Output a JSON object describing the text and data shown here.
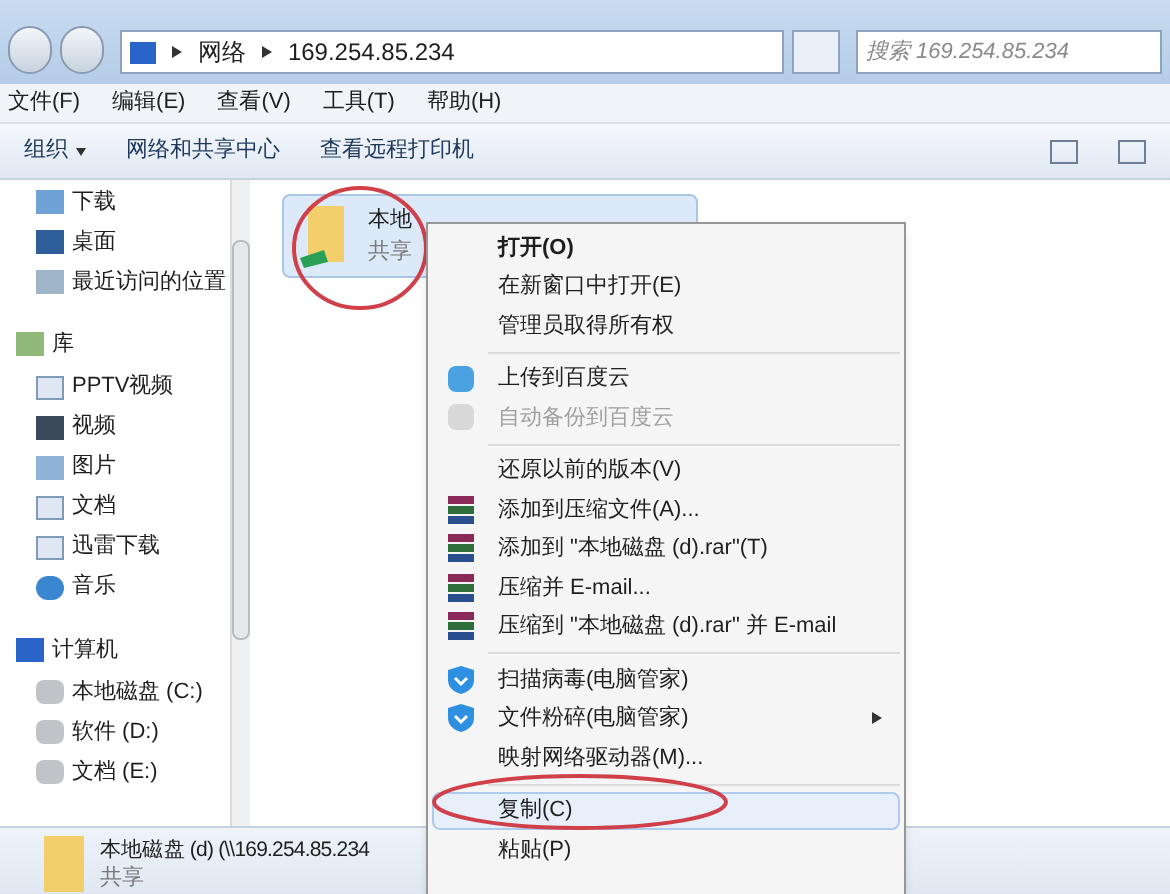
{
  "address_bar": {
    "crumbs": [
      "网络",
      "169.254.85.234"
    ]
  },
  "search": {
    "placeholder": "搜索 169.254.85.234"
  },
  "menu_bar": [
    "文件(F)",
    "编辑(E)",
    "查看(V)",
    "工具(T)",
    "帮助(H)"
  ],
  "toolbar": [
    {
      "label": "组织",
      "dropdown": true
    },
    {
      "label": "网络和共享中心",
      "dropdown": false
    },
    {
      "label": "查看远程打印机",
      "dropdown": false
    }
  ],
  "sidebar": {
    "groups": [
      {
        "children": [
          {
            "label": "下载"
          },
          {
            "label": "桌面"
          },
          {
            "label": "最近访问的位置"
          }
        ]
      },
      {
        "label": "库",
        "children": [
          {
            "label": "PPTV视频"
          },
          {
            "label": "视频"
          },
          {
            "label": "图片"
          },
          {
            "label": "文档"
          },
          {
            "label": "迅雷下载"
          },
          {
            "label": "音乐"
          }
        ]
      },
      {
        "label": "计算机",
        "children": [
          {
            "label": "本地磁盘 (C:)"
          },
          {
            "label": "软件 (D:)"
          },
          {
            "label": "文档 (E:)"
          }
        ]
      }
    ]
  },
  "folder": {
    "name": "本地",
    "subtitle": "共享",
    "selected": true
  },
  "context_menu": [
    {
      "kind": "item",
      "label": "打开(O)",
      "bold": true,
      "disabled": false,
      "submenu": false,
      "selected": false
    },
    {
      "kind": "item",
      "label": "在新窗口中打开(E)",
      "bold": false,
      "disabled": false,
      "submenu": false,
      "selected": false
    },
    {
      "kind": "item",
      "label": "管理员取得所有权",
      "bold": false,
      "disabled": false,
      "submenu": false,
      "selected": false
    },
    {
      "kind": "separator"
    },
    {
      "kind": "cloud",
      "label": "上传到百度云",
      "bold": false,
      "disabled": false,
      "submenu": false,
      "selected": false
    },
    {
      "kind": "cloud",
      "label": "自动备份到百度云",
      "bold": false,
      "disabled": true,
      "submenu": false,
      "selected": false
    },
    {
      "kind": "separator"
    },
    {
      "kind": "item",
      "label": "还原以前的版本(V)",
      "bold": false,
      "disabled": false,
      "submenu": false,
      "selected": false
    },
    {
      "kind": "archive",
      "label": "添加到压缩文件(A)...",
      "bold": false,
      "disabled": false,
      "submenu": false,
      "selected": false
    },
    {
      "kind": "archive",
      "label": "添加到 \"本地磁盘 (d).rar\"(T)",
      "bold": false,
      "disabled": false,
      "submenu": false,
      "selected": false
    },
    {
      "kind": "archive",
      "label": "压缩并 E-mail...",
      "bold": false,
      "disabled": false,
      "submenu": false,
      "selected": false
    },
    {
      "kind": "archive",
      "label": "压缩到 \"本地磁盘 (d).rar\" 并 E-mail",
      "bold": false,
      "disabled": false,
      "submenu": false,
      "selected": false
    },
    {
      "kind": "separator"
    },
    {
      "kind": "shield",
      "label": "扫描病毒(电脑管家)",
      "bold": false,
      "disabled": false,
      "submenu": false,
      "selected": false
    },
    {
      "kind": "shield",
      "label": "文件粉碎(电脑管家)",
      "bold": false,
      "disabled": false,
      "submenu": true,
      "selected": false
    },
    {
      "kind": "item",
      "label": "映射网络驱动器(M)...",
      "bold": false,
      "disabled": false,
      "submenu": false,
      "selected": false
    },
    {
      "kind": "separator"
    },
    {
      "kind": "item",
      "label": "复制(C)",
      "bold": false,
      "disabled": false,
      "submenu": false,
      "selected": true
    },
    {
      "kind": "item",
      "label": "粘贴(P)",
      "bold": false,
      "disabled": false,
      "submenu": false,
      "selected": false
    }
  ],
  "details": {
    "name": "本地磁盘 (d) (\\\\169.254.85.234",
    "subtitle": "共享"
  }
}
